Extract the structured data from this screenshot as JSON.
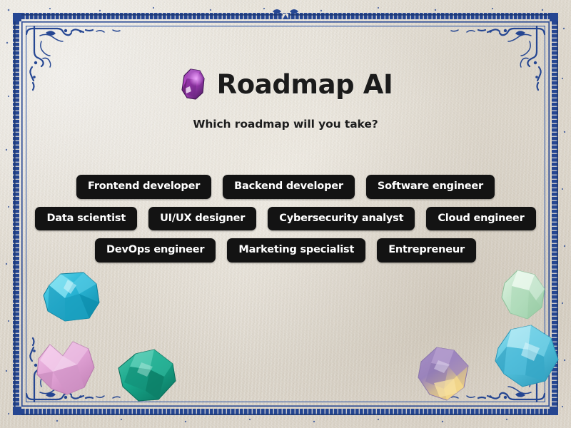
{
  "app": {
    "title": "Roadmap AI",
    "title_gem_icon": "amethyst-gem-icon",
    "subtitle": "Which roadmap will you take?",
    "background_color": "#e8e2d7",
    "frame_color": "#1c3f8f",
    "button_bg_color": "#131313",
    "button_text_color": "#ffffff"
  },
  "options": {
    "rows": [
      {
        "buttons": [
          {
            "label": "Frontend developer"
          },
          {
            "label": "Backend developer"
          },
          {
            "label": "Software engineer"
          }
        ]
      },
      {
        "buttons": [
          {
            "label": "Data scientist"
          },
          {
            "label": "UI/UX designer"
          },
          {
            "label": "Cybersecurity analyst"
          },
          {
            "label": "Cloud engineer"
          }
        ]
      },
      {
        "buttons": [
          {
            "label": "DevOps engineer"
          },
          {
            "label": "Marketing specialist"
          },
          {
            "label": "Entrepreneur"
          }
        ]
      }
    ]
  },
  "decorations": {
    "gems": [
      {
        "name": "cyan-gem",
        "color": "#3fc4dd"
      },
      {
        "name": "pink-gem",
        "color": "#d9a0cd"
      },
      {
        "name": "emerald-gem",
        "color": "#22a78b"
      },
      {
        "name": "mint-gem",
        "color": "#bfe2c6"
      },
      {
        "name": "ametrine-gem",
        "color": "#9f86bd"
      },
      {
        "name": "aquamarine-gem",
        "color": "#63c6dd"
      }
    ]
  }
}
